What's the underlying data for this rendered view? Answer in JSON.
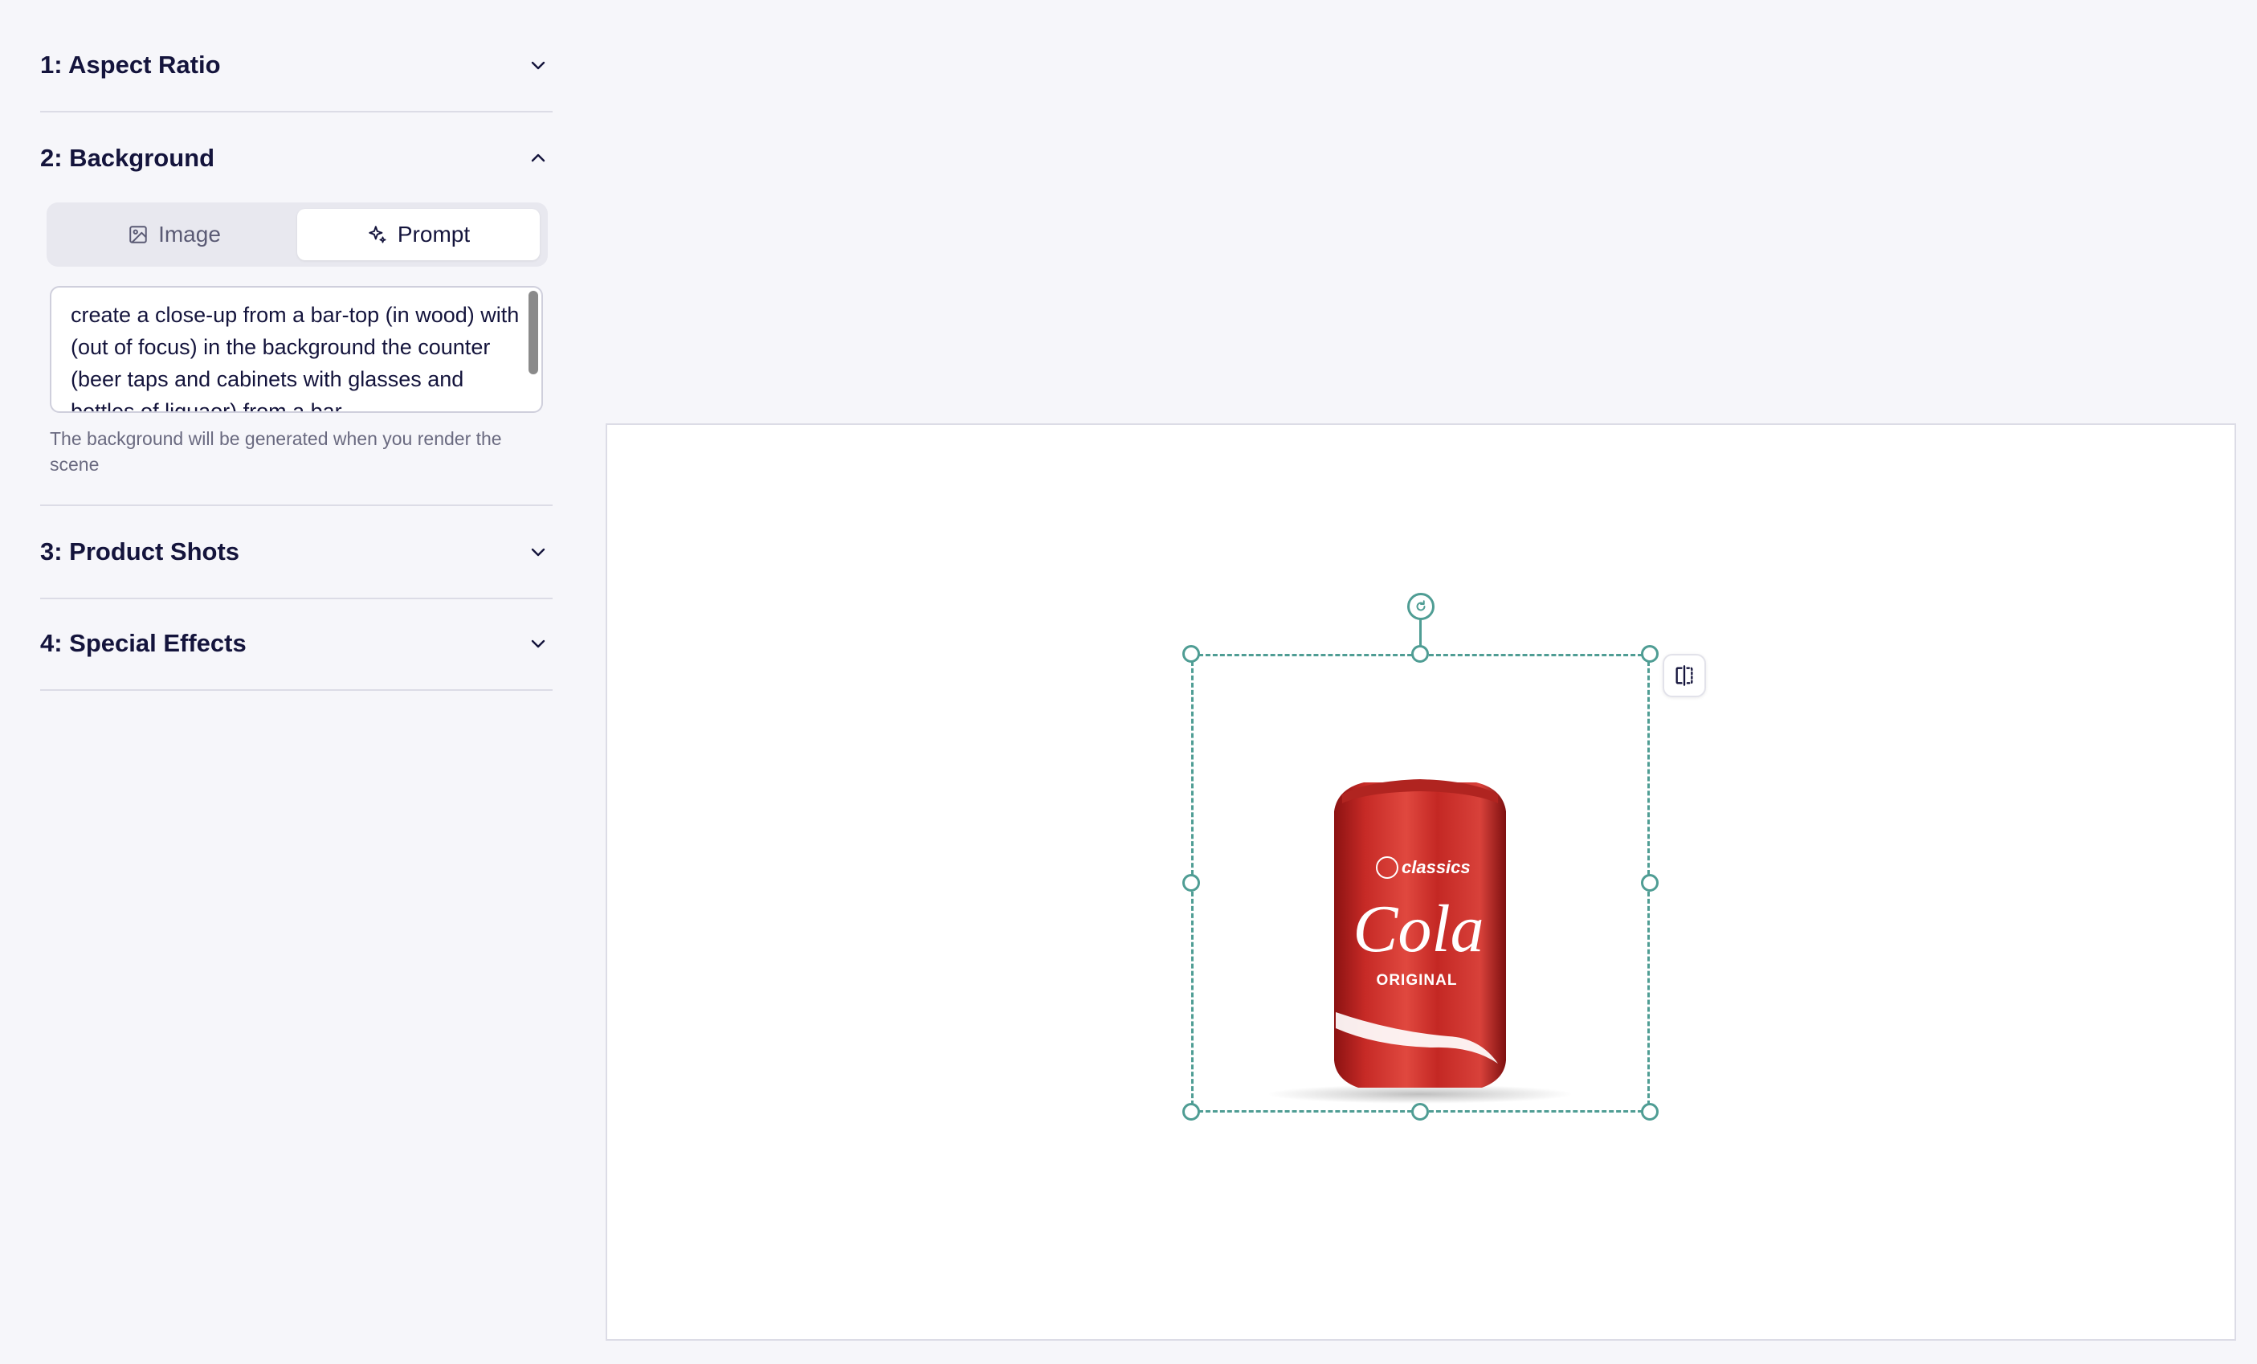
{
  "sidebar": {
    "sections": [
      {
        "title": "1: Aspect Ratio",
        "expanded": false
      },
      {
        "title": "2: Background",
        "expanded": true
      },
      {
        "title": "3: Product Shots",
        "expanded": false
      },
      {
        "title": "4: Special Effects",
        "expanded": false
      }
    ],
    "background": {
      "tabs": [
        {
          "label": "Image",
          "icon": "image-icon",
          "active": false
        },
        {
          "label": "Prompt",
          "icon": "sparkle-icon",
          "active": true
        }
      ],
      "prompt_value": "create a close-up from a bar-top (in wood) with (out of focus) in the background the counter (beer taps and cabinets with glasses and bottles of liquaor) from a bar",
      "helper_text": "The background will be generated when you render the scene"
    }
  },
  "canvas": {
    "product": {
      "brand_small": "classics",
      "name": "Cola",
      "variant": "ORIGINAL"
    },
    "selection_color": "#4f9d94",
    "flip_icon": "flip-horizontal-icon",
    "rotate_icon": "rotate-icon"
  }
}
